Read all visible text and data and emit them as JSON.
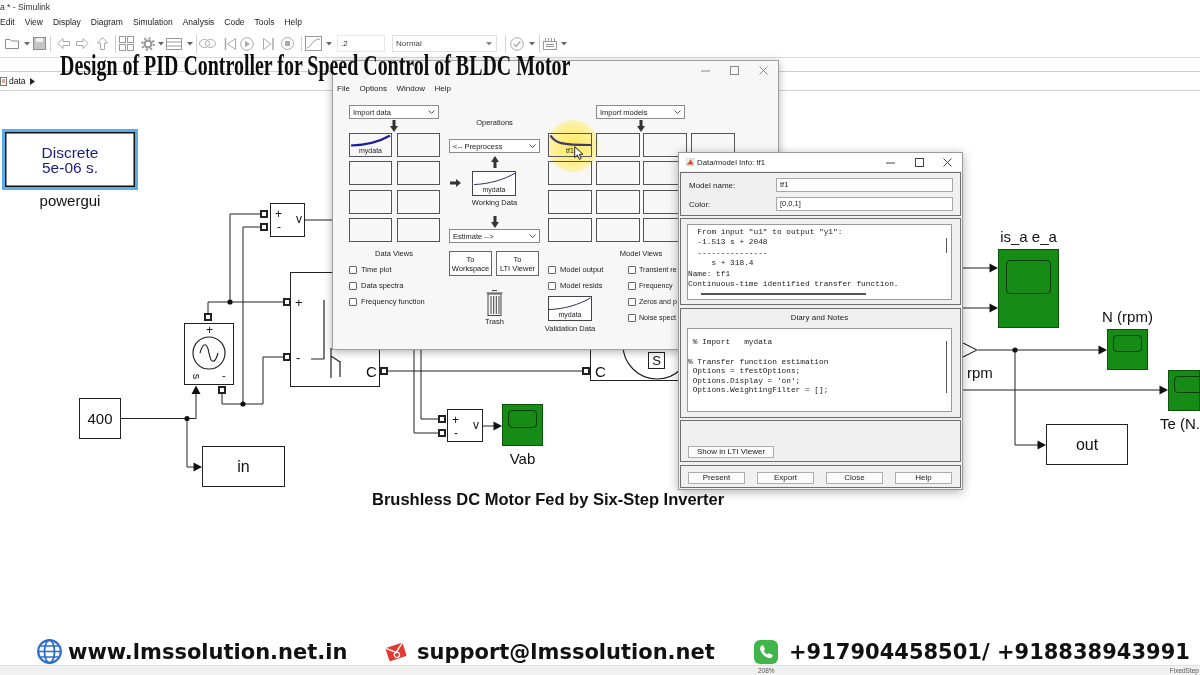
{
  "simulink": {
    "title": "a * - Simulink",
    "menu": [
      "Edit",
      "View",
      "Display",
      "Diagram",
      "Simulation",
      "Analysis",
      "Code",
      "Tools",
      "Help"
    ],
    "stop_time": ".2",
    "sim_mode": "Normal",
    "breadcrumb": "data"
  },
  "overlay_title": "Design of PID Controller for Speed Control of BLDC Motor",
  "diagram": {
    "blocks": [
      {
        "kind": "powergui",
        "lines": [
          "Discrete",
          "5e-06 s."
        ],
        "label": "powergui",
        "selected": true
      },
      {
        "kind": "voltmeter",
        "plus": "+",
        "minus": "-",
        "output": "v"
      },
      {
        "kind": "source",
        "plus": "+",
        "input": "s",
        "minus": "-"
      },
      {
        "kind": "inverter",
        "plus": "+",
        "minus": "-",
        "output": "C"
      },
      {
        "kind": "constant",
        "value": "400"
      },
      {
        "kind": "output",
        "value": "in"
      },
      {
        "kind": "motor",
        "input": "C",
        "port": "S"
      },
      {
        "kind": "voltmeter",
        "plus": "+",
        "minus": "-",
        "output": "v"
      },
      {
        "kind": "scope",
        "label": "Vab"
      },
      {
        "kind": "scope",
        "label": "is_a e_a"
      },
      {
        "kind": "port",
        "label": "rpm"
      },
      {
        "kind": "scope",
        "label": "N (rpm)"
      },
      {
        "kind": "output",
        "value": "out"
      },
      {
        "kind": "scope",
        "label": "Te (N."
      }
    ],
    "caption": "Brushless DC Motor Fed by Six-Step Inverter"
  },
  "system_identification": {
    "menu": [
      "File",
      "Options",
      "Window",
      "Help"
    ],
    "import_data": "Import data",
    "data_slots": [
      "mydata"
    ],
    "data_views": {
      "label": "Data Views",
      "options": [
        {
          "label": "Time plot",
          "checked": false
        },
        {
          "label": "Data spectra",
          "checked": false
        },
        {
          "label": "Frequency function",
          "checked": false
        }
      ]
    },
    "operations": {
      "label": "Operations",
      "preprocess": "<-- Preprocess",
      "working_data": "mydata",
      "working_data_label": "Working Data",
      "estimate": "Estimate -->",
      "buttons": [
        {
          "lines": [
            "To",
            "Workspace"
          ]
        },
        {
          "lines": [
            "To",
            "LTI Viewer"
          ]
        }
      ],
      "trash": "Trash"
    },
    "import_models": "Import models",
    "model_slots": [
      "tf1"
    ],
    "model_views": {
      "label": "Model Views",
      "options": [
        {
          "label": "Model output",
          "checked": false
        },
        {
          "label": "Model resids",
          "checked": false
        }
      ],
      "more_options": [
        {
          "label": "Transient re",
          "checked": false
        },
        {
          "label": "Frequency",
          "checked": false
        },
        {
          "label": "Zeros and p",
          "checked": false
        },
        {
          "label": "Noise spect",
          "checked": false
        }
      ],
      "validation_data": "mydata",
      "validation_label": "Validation Data"
    }
  },
  "model_info": {
    "title": "Data/model Info: tf1",
    "fields": [
      {
        "label": "Model name:",
        "value": "tf1"
      },
      {
        "label": "Color:",
        "value": "[0,0,1]"
      }
    ],
    "info_lines": [
      "  From input \"u1\" to output \"y1\":",
      "  -1.513 s + 2048",
      "  ---------------",
      "     s + 318.4",
      "Name: tf1",
      "Continuous-time identified transfer function."
    ],
    "diary_title": "Diary and Notes",
    "diary": [
      [
        " % Import   mydata"
      ],
      [
        "% Transfer function estimation",
        " Options = tfestOptions;",
        " Options.Display = 'on';",
        " Options.WeightingFilter = [];"
      ]
    ],
    "show_button": "Show in LTI Viewer",
    "buttons": [
      "Present",
      "Export",
      "Close",
      "Help"
    ]
  },
  "status_bar": {
    "zoom": "208%",
    "solver": "FixedStep"
  },
  "footer": {
    "website": "www.lmssolution.net.in",
    "email": "support@lmssolution.net",
    "phone": "+917904458501/ +918838943991"
  }
}
